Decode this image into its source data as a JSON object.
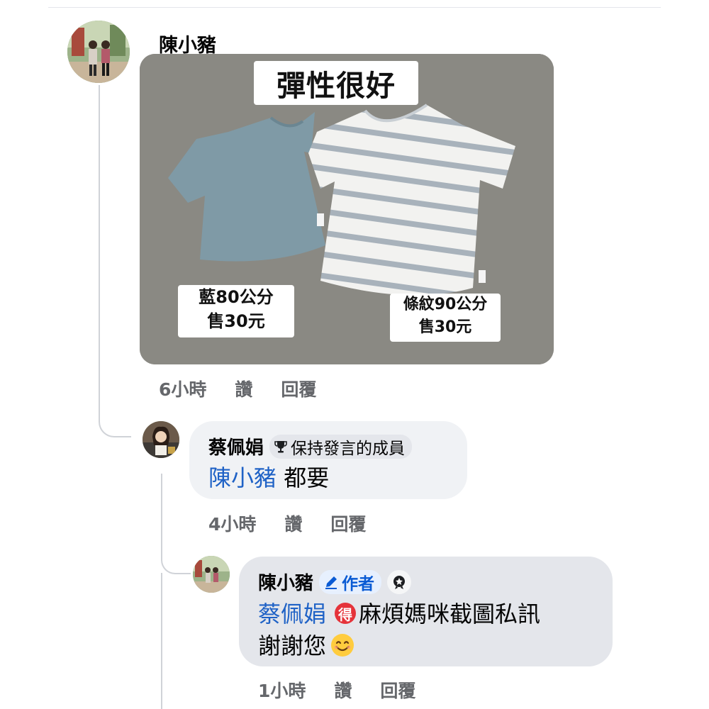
{
  "post": {
    "author": "陳小豬",
    "photo": {
      "title": "彈性很好",
      "tag_blue_line1": "藍80公分",
      "tag_blue_line2": "售30元",
      "tag_stripe_line1": "條紋90公分",
      "tag_stripe_line2": "售30元"
    },
    "time": "6小時",
    "like_label": "讚",
    "reply_label": "回覆"
  },
  "reply1": {
    "author": "蔡佩娟",
    "badge_icon": "trophy-icon",
    "badge_label": "保持發言的成員",
    "mention": "陳小豬",
    "text": "都要",
    "time": "4小時",
    "like_label": "讚",
    "reply_label": "回覆"
  },
  "reply2": {
    "author": "陳小豬",
    "author_badge_icon": "pencil-icon",
    "author_badge_label": "作者",
    "extra_badge_icon": "award-badge-icon",
    "mention": "蔡佩娟",
    "emoji_de": "得",
    "text_line1": "麻煩媽咪截圖私訊",
    "text_line2": "謝謝您",
    "emoji_smile": "smiling-face-emoji",
    "time": "1小時",
    "like_label": "讚",
    "reply_label": "回覆"
  },
  "colors": {
    "mention_blue": "#1f62c6",
    "meta_gray": "#65676b",
    "bubble_light": "#f0f2f5",
    "bubble_dark": "#e4e6eb",
    "author_badge_blue": "#0a5bd4",
    "de_red": "#e5333a"
  }
}
